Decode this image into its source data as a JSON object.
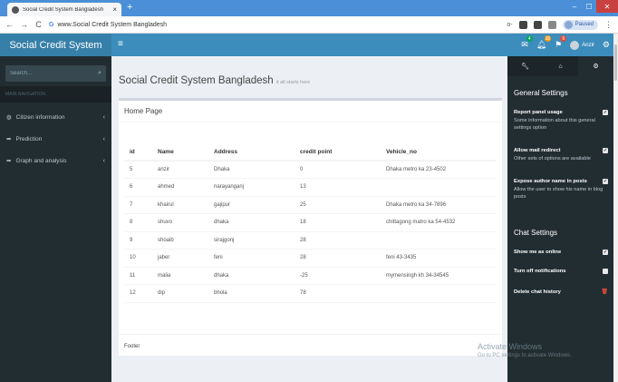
{
  "browser": {
    "tab_title": "Social Credit System Bangladesh",
    "tab_close": "×",
    "new_tab": "+",
    "url": "www.Social Credit System Bangladesh",
    "back": "←",
    "forward": "→",
    "reload": "C",
    "search_engine_glyph": "G",
    "key_icon": "o-",
    "profile_status": "Paused",
    "menu": "⋮",
    "window_min": "–",
    "window_max": "☐",
    "window_close": "✕"
  },
  "header": {
    "logo": "Social Credit System",
    "menu_toggle": "≡",
    "mail_badge": "4",
    "notif_badge": "10",
    "task_badge": "9",
    "user_name": "Anzir",
    "colors": {
      "primary": "#3c8dbc",
      "logo_bg": "#367fa9",
      "sidebar": "#222d32"
    }
  },
  "sidebar": {
    "search_placeholder": "Search...",
    "nav_header": "MAIN NAVIGATION",
    "items": [
      {
        "label": "Citizen information",
        "icon": "dashboard-icon"
      },
      {
        "label": "Prediction",
        "icon": "share-icon"
      },
      {
        "label": "Graph and analysis",
        "icon": "share-icon"
      }
    ]
  },
  "content": {
    "title": "Social Credit System Bangladesh",
    "subtitle": "it all starts here",
    "box_title": "Home Page",
    "footer": "Footer",
    "table": {
      "headers": [
        "id",
        "Name",
        "Address",
        "credit point",
        "Vehicle_no"
      ],
      "rows": [
        [
          "5",
          "anzir",
          "Dhaka",
          "0",
          "Dhaka metro ka 23-4502"
        ],
        [
          "6",
          "ahmed",
          "narayanganj",
          "13",
          ""
        ],
        [
          "7",
          "khairul",
          "gajipur",
          "25",
          "Dhaka metro ka 34-7896"
        ],
        [
          "8",
          "shuvo",
          "dhaka",
          "18",
          "chittagong matro ka 54-4532"
        ],
        [
          "9",
          "shoaib",
          "sirajgonj",
          "28",
          ""
        ],
        [
          "10",
          "jaber",
          "feni",
          "28",
          "feni 43-3435"
        ],
        [
          "11",
          "malia",
          "dhaka",
          "-25",
          "mymensingh kh 34-34545"
        ],
        [
          "12",
          "dip",
          "bhola",
          "78",
          ""
        ]
      ]
    }
  },
  "control_sidebar": {
    "general_heading": "General Settings",
    "chat_heading": "Chat Settings",
    "general": [
      {
        "title": "Report panel usage",
        "desc": "Some information about this general settings option"
      },
      {
        "title": "Allow mail redirect",
        "desc": "Other sets of options are available"
      },
      {
        "title": "Expose author name in posts",
        "desc": "Allow the user to show his name in blog posts"
      }
    ],
    "chat": [
      {
        "title": "Show me as online"
      },
      {
        "title": "Turn off notifications"
      },
      {
        "title": "Delete chat history"
      }
    ]
  },
  "watermark": {
    "line1": "Activate Windows",
    "line2": "Go to PC settings to activate Windows."
  }
}
